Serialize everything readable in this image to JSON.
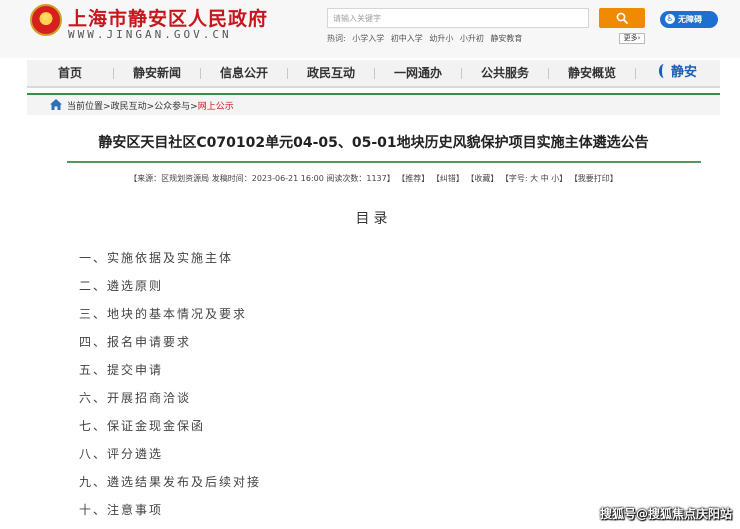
{
  "header": {
    "site_title": "上海市静安区人民政府",
    "site_url": "WWW.JINGAN.GOV.CN",
    "search": {
      "placeholder": "请输入关键字"
    },
    "search_icon": "magnifier-icon",
    "accessibility_label": "无障碍",
    "hot_label": "热词:",
    "hot_words": [
      "小学入学",
      "初中入学",
      "幼升小",
      "小升初",
      "静安教育"
    ],
    "more_label": "更多"
  },
  "nav": {
    "items": [
      "首页",
      "静安新闻",
      "信息公开",
      "政民互动",
      "一网通办",
      "公共服务",
      "静安概览"
    ],
    "logo_text": "静安"
  },
  "breadcrumb": {
    "icon": "home-icon",
    "items": [
      "当前位置",
      "政民互动",
      "公众参与",
      "网上公示"
    ],
    "separator": ">"
  },
  "article": {
    "title": "静安区天目社区C070102单元04-05、05-01地块历史风貌保护项目实施主体遴选公告",
    "meta": {
      "source": "【来源：区规划资源局 发稿时间：2023-06-21 16:00 阅读次数：1137】",
      "recommend": "【推荐】",
      "correct": "【纠错】",
      "favorite": "【收藏】",
      "font_label": "【字号:",
      "font_large": "大",
      "font_medium": "中",
      "font_small": "小",
      "font_close": "】",
      "print": "【我要打印】"
    },
    "toc_heading": "目录",
    "toc": [
      "一、实施依据及实施主体",
      "二、遴选原则",
      "三、地块的基本情况及要求",
      "四、报名申请要求",
      "五、提交申请",
      "六、开展招商洽谈",
      "七、保证金现金保函",
      "八、评分遴选",
      "九、遴选结果发布及后续对接",
      "十、注意事项"
    ]
  },
  "watermark": "搜狐号@搜狐焦点庆阳站",
  "colors": {
    "brand_red": "#c8161d",
    "search_orange": "#f08a00",
    "access_blue": "#1d6fd1",
    "rule_green": "#4e9a5b"
  }
}
